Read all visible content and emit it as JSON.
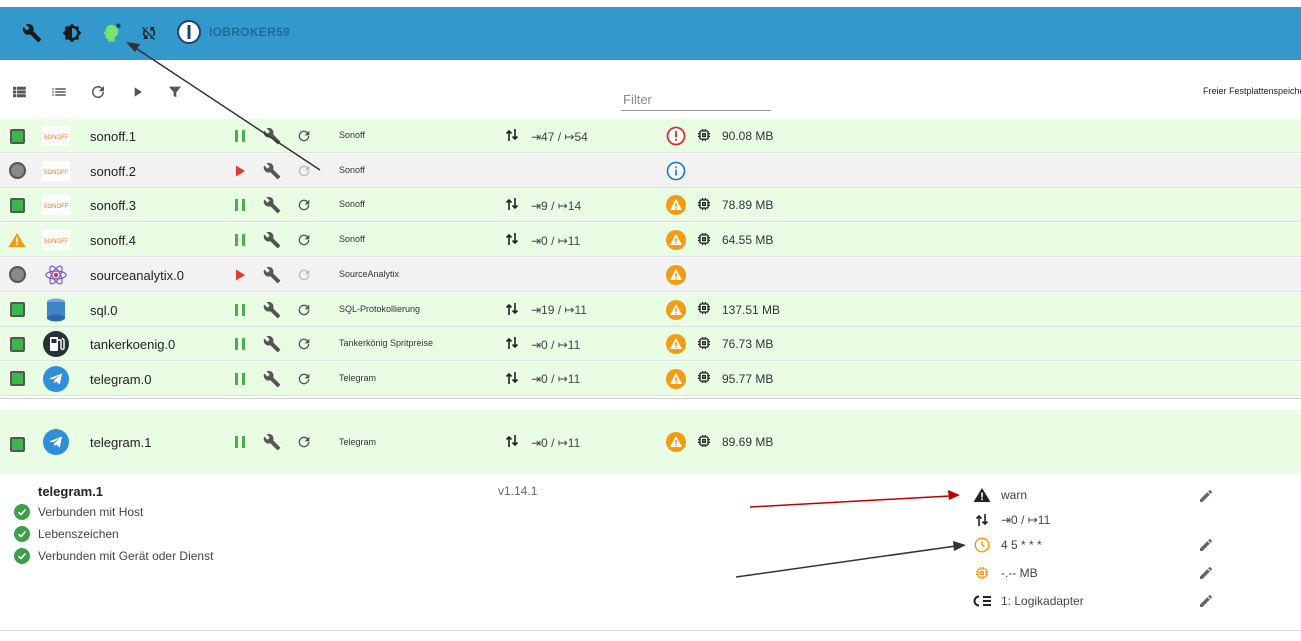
{
  "header": {
    "brand": "IOBROKER59",
    "icons": [
      "wrench-icon",
      "brightness-icon",
      "expert-mode-icon",
      "sync-off-icon"
    ]
  },
  "toolbar": {
    "filter_placeholder": "Filter",
    "disk_label": "Freier Festplattenspeicher"
  },
  "adapters": [
    {
      "name": "sonoff.1",
      "status": "running",
      "logo": "Sonoff",
      "title": "Sonoff",
      "events": "⇥47 / ↦54",
      "badge": "error",
      "memory": "90.08 MB",
      "bg": "green"
    },
    {
      "name": "sonoff.2",
      "status": "stopped",
      "logo": "Sonoff",
      "title": "Sonoff",
      "events": "",
      "badge": "info",
      "memory": "",
      "bg": "grey"
    },
    {
      "name": "sonoff.3",
      "status": "running",
      "logo": "Sonoff",
      "title": "Sonoff",
      "events": "⇥9 / ↦14",
      "badge": "warn",
      "memory": "78.89 MB",
      "bg": "green"
    },
    {
      "name": "sonoff.4",
      "status": "warning",
      "logo": "Sonoff",
      "title": "Sonoff",
      "events": "⇥0 / ↦11",
      "badge": "warn",
      "memory": "64.55 MB",
      "bg": "green"
    },
    {
      "name": "sourceanalytix.0",
      "status": "stopped",
      "logo": "sourceanalytix",
      "title": "SourceAnalytix",
      "events": "",
      "badge": "warn",
      "memory": "",
      "bg": "grey"
    },
    {
      "name": "sql.0",
      "status": "running",
      "logo": "sql",
      "title": "SQL-Protokollierung",
      "events": "⇥19 / ↦11",
      "badge": "warn",
      "memory": "137.51 MB",
      "bg": "green"
    },
    {
      "name": "tankerkoenig.0",
      "status": "running",
      "logo": "tankerkoenig",
      "title": "Tankerkönig Spritpreise",
      "events": "⇥0 / ↦11",
      "badge": "warn",
      "memory": "76.73 MB",
      "bg": "green"
    },
    {
      "name": "telegram.0",
      "status": "running",
      "logo": "telegram",
      "title": "Telegram",
      "events": "⇥0 / ↦11",
      "badge": "warn",
      "memory": "95.77 MB",
      "bg": "green"
    }
  ],
  "expanded": {
    "name": "telegram.1",
    "title": "Telegram",
    "events": "⇥0 / ↦11",
    "memory": "89.69 MB",
    "version": "v1.14.1",
    "checks": [
      "Verbunden mit Host",
      "Lebenszeichen",
      "Verbunden mit Gerät oder Dienst"
    ],
    "loglevel": "warn",
    "events_detail": "⇥0 / ↦11",
    "schedule": "4 5 * * *",
    "ram_limit": "-.-- MB",
    "tier": "1: Logikadapter"
  },
  "colors": {
    "accent": "#3399cc",
    "running_bg": "#e8fde4",
    "stopped_bg": "#f2f2f2",
    "warn": "#f39c12",
    "error": "#d32f2f",
    "info": "#1976d2",
    "arrow_red": "#c00000",
    "arrow_dark": "#333333"
  }
}
